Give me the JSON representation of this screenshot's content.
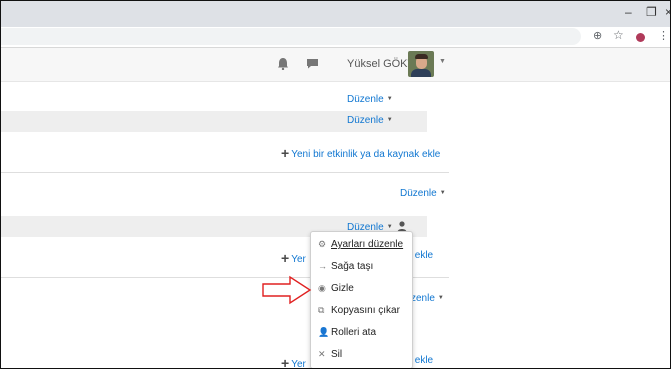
{
  "browser": {
    "window_controls": [
      "–",
      "❐",
      "×"
    ],
    "toolbar_icons": [
      "zoom-icon",
      "star-icon",
      "extension-icon",
      "menu-icon"
    ],
    "zoom_glyph": "⊕",
    "star_glyph": "☆",
    "menu_glyph": "⋮"
  },
  "navbar": {
    "username": "Yüksel GÖKTAŞ",
    "caret": "▼"
  },
  "content": {
    "edit_label": "Düzenle",
    "add_activity_label": "Yeni bir etkinlik ya da kaynak ekle",
    "truncated_add_left": "Yer",
    "truncated_add_right": "k ekle",
    "truncated_edit_right": "zenle"
  },
  "dropdown": {
    "items": [
      {
        "label": "Ayarları düzenle",
        "icon": "gear-icon",
        "glyph": "⚙"
      },
      {
        "label": "Sağa taşı",
        "icon": "arrow-right-icon",
        "glyph": "→"
      },
      {
        "label": "Gizle",
        "icon": "eye-icon",
        "glyph": "◉"
      },
      {
        "label": "Kopyasını çıkar",
        "icon": "copy-icon",
        "glyph": "⧉"
      },
      {
        "label": "Rolleri ata",
        "icon": "assign-roles-icon",
        "glyph": "👤"
      },
      {
        "label": "Sil",
        "icon": "delete-icon",
        "glyph": "✕"
      }
    ]
  },
  "colors": {
    "link": "#1177d1",
    "annotation_arrow": "#e02020"
  }
}
